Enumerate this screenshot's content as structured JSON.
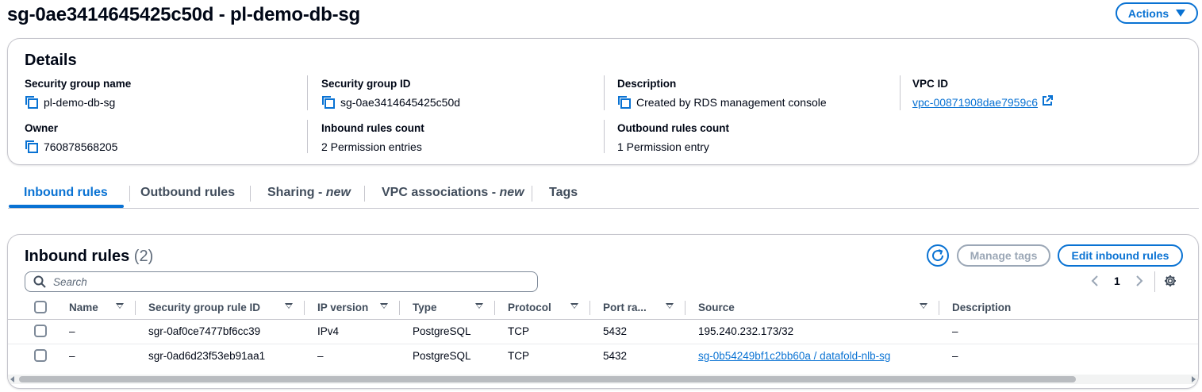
{
  "header": {
    "title": "sg-0ae3414645425c50d - pl-demo-db-sg",
    "actions_label": "Actions"
  },
  "details": {
    "title": "Details",
    "fields": [
      {
        "label": "Security group name",
        "value": "pl-demo-db-sg",
        "copyable": true
      },
      {
        "label": "Security group ID",
        "value": "sg-0ae3414645425c50d",
        "copyable": true
      },
      {
        "label": "Description",
        "value": "Created by RDS management console",
        "copyable": true
      },
      {
        "label": "VPC ID",
        "value": "vpc-00871908dae7959c6",
        "link": true
      },
      {
        "label": "Owner",
        "value": "760878568205",
        "copyable": true
      },
      {
        "label": "Inbound rules count",
        "value": "2 Permission entries"
      },
      {
        "label": "Outbound rules count",
        "value": "1 Permission entry"
      }
    ]
  },
  "tabs": [
    {
      "label": "Inbound rules",
      "active": true
    },
    {
      "label": "Outbound rules",
      "active": false
    },
    {
      "label": "Sharing - ",
      "suffix": "new",
      "active": false
    },
    {
      "label": "VPC associations - ",
      "suffix": "new",
      "active": false
    },
    {
      "label": "Tags",
      "active": false
    }
  ],
  "inbound": {
    "title": "Inbound rules",
    "count": "(2)",
    "manage_tags_label": "Manage tags",
    "edit_label": "Edit inbound rules",
    "search_placeholder": "Search",
    "page": "1",
    "columns": [
      "Name",
      "Security group rule ID",
      "IP version",
      "Type",
      "Protocol",
      "Port ra...",
      "Source",
      "Description"
    ],
    "rows": [
      {
        "name": "–",
        "rule_id": "sgr-0af0ce7477bf6cc39",
        "ip_version": "IPv4",
        "type": "PostgreSQL",
        "protocol": "TCP",
        "port": "5432",
        "source": "195.240.232.173/32",
        "description": "–"
      },
      {
        "name": "–",
        "rule_id": "sgr-0ad6d23f53eb91aa1",
        "ip_version": "–",
        "type": "PostgreSQL",
        "protocol": "TCP",
        "port": "5432",
        "source": "sg-0b54249bf1c2bb60a / datafold-nlb-sg",
        "description": "–"
      }
    ]
  },
  "colors": {
    "accent": "#0972d3",
    "text": "#000716",
    "border": "#c6c6cd",
    "disabled": "#9ba7b6"
  }
}
